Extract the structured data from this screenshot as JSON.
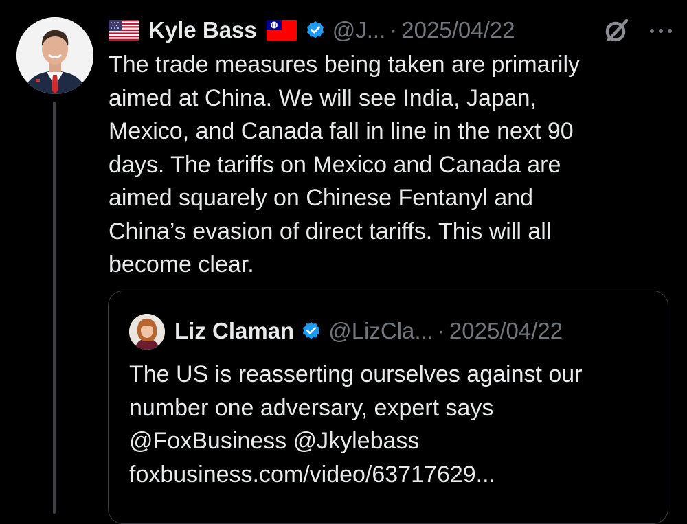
{
  "tweet": {
    "author_name": "Kyle Bass",
    "handle": "@J...",
    "separator": "·",
    "date": "2025/04/22",
    "text_lines": [
      "The trade measures being taken are primarily",
      "aimed at China. We will see India, Japan,",
      "Mexico, and Canada fall in line in the next 90",
      "days. The tariffs on Mexico and Canada are",
      "aimed squarely on Chinese Fentanyl and",
      "China’s evasion of direct tariffs. This will all",
      "become clear."
    ],
    "icons": [
      "us-flag-icon",
      "taiwan-flag-icon",
      "verified-badge-icon",
      "grok-icon",
      "more-options-icon"
    ]
  },
  "quote": {
    "author_name": "Liz Claman",
    "handle": "@LizCla...",
    "separator": "·",
    "date": "2025/04/22",
    "text_lines": [
      "The US is reasserting ourselves against our",
      "number one adversary, expert says",
      "@FoxBusiness @Jkylebass",
      "foxbusiness.com/video/63717629..."
    ]
  },
  "colors": {
    "background": "#000000",
    "text": "#e7e9ea",
    "secondary_text": "#71767b",
    "verified_blue": "#1d9bf0",
    "border": "#3a3d42"
  }
}
